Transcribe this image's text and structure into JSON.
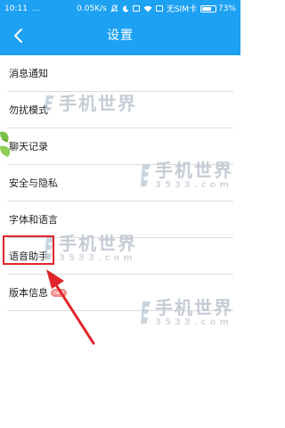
{
  "status_bar": {
    "time": "10:11",
    "dots": "...",
    "speed": "0.05K/s",
    "carrier": "无SIM卡",
    "battery": "73%",
    "battery_level": 0.73
  },
  "header": {
    "title": "设置"
  },
  "menu": [
    {
      "label": "消息通知"
    },
    {
      "label": "勿扰模式"
    },
    {
      "label": "聊天记录"
    },
    {
      "label": "安全与隐私"
    },
    {
      "label": "字体和语言"
    },
    {
      "label": "语音助手"
    },
    {
      "label": "版本信息",
      "badge": "new"
    }
  ],
  "watermark": {
    "text": "手机世界",
    "number": "3533.com"
  },
  "colors": {
    "accent": "#1da1f2",
    "highlight": "#e0252a",
    "arrow": "#e0252a"
  }
}
